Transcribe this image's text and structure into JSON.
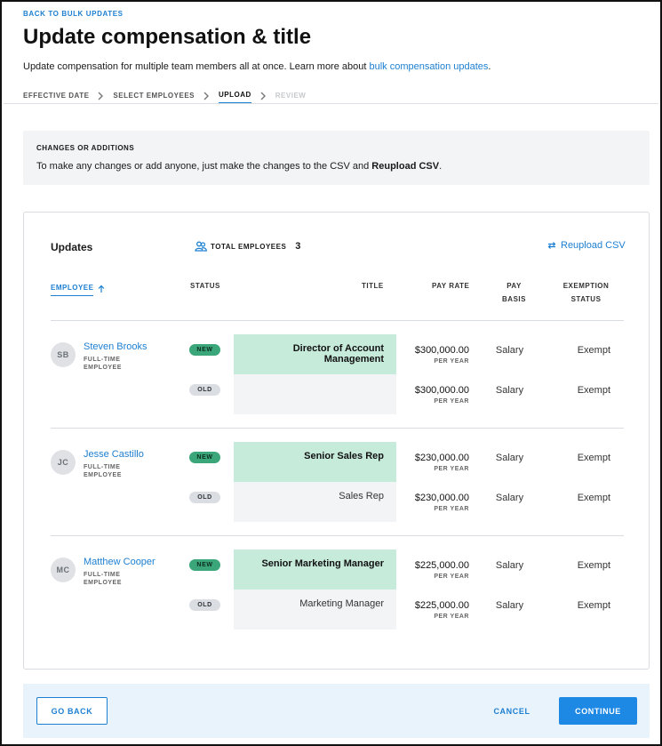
{
  "header": {
    "back_link": "BACK TO BULK UPDATES",
    "title": "Update compensation & title",
    "subtitle_text": "Update compensation for multiple team members all at once. Learn more about ",
    "subtitle_link": "bulk compensation updates",
    "subtitle_end": "."
  },
  "stepper": {
    "steps": [
      "EFFECTIVE DATE",
      "SELECT EMPLOYEES",
      "UPLOAD",
      "REVIEW"
    ],
    "active": "UPLOAD"
  },
  "notice": {
    "title": "CHANGES OR ADDITIONS",
    "body_text": "To make any changes or add anyone, just make the changes to the CSV and ",
    "body_bold": "Reupload CSV",
    "body_end": "."
  },
  "card": {
    "title": "Updates",
    "total_label": "TOTAL EMPLOYEES",
    "total_count": "3",
    "reupload_label": "Reupload CSV",
    "columns": {
      "employee": "EMPLOYEE",
      "status": "STATUS",
      "title": "TITLE",
      "pay_rate": "PAY RATE",
      "pay_basis_1": "PAY",
      "pay_basis_2": "BASIS",
      "exemption_1": "EXEMPTION",
      "exemption_2": "STATUS"
    },
    "employees": [
      {
        "initials": "SB",
        "name": "Steven Brooks",
        "type": "FULL-TIME EMPLOYEE",
        "new": {
          "badge": "NEW",
          "title": "Director of Account Management",
          "rate": "$300,000.00",
          "per": "PER YEAR",
          "basis": "Salary",
          "exempt": "Exempt"
        },
        "old": {
          "badge": "OLD",
          "title": "",
          "rate": "$300,000.00",
          "per": "PER YEAR",
          "basis": "Salary",
          "exempt": "Exempt"
        }
      },
      {
        "initials": "JC",
        "name": "Jesse Castillo",
        "type": "FULL-TIME EMPLOYEE",
        "new": {
          "badge": "NEW",
          "title": "Senior Sales Rep",
          "rate": "$230,000.00",
          "per": "PER YEAR",
          "basis": "Salary",
          "exempt": "Exempt"
        },
        "old": {
          "badge": "OLD",
          "title": "Sales Rep",
          "rate": "$230,000.00",
          "per": "PER YEAR",
          "basis": "Salary",
          "exempt": "Exempt"
        }
      },
      {
        "initials": "MC",
        "name": "Matthew Cooper",
        "type": "FULL-TIME EMPLOYEE",
        "new": {
          "badge": "NEW",
          "title": "Senior Marketing Manager",
          "rate": "$225,000.00",
          "per": "PER YEAR",
          "basis": "Salary",
          "exempt": "Exempt"
        },
        "old": {
          "badge": "OLD",
          "title": "Marketing Manager",
          "rate": "$225,000.00",
          "per": "PER YEAR",
          "basis": "Salary",
          "exempt": "Exempt"
        }
      }
    ]
  },
  "footer": {
    "back_label": "GO BACK",
    "cancel_label": "CANCEL",
    "continue_label": "CONTINUE"
  },
  "colors": {
    "accent": "#1d7fd1",
    "new_badge": "#3aa67a",
    "new_row": "#c6ebdb",
    "old_row": "#f3f4f6",
    "footer_bg": "#e9f3fb"
  },
  "icons": [
    "chevron-right-icon",
    "people-icon",
    "refresh-icon",
    "arrow-up-icon"
  ]
}
